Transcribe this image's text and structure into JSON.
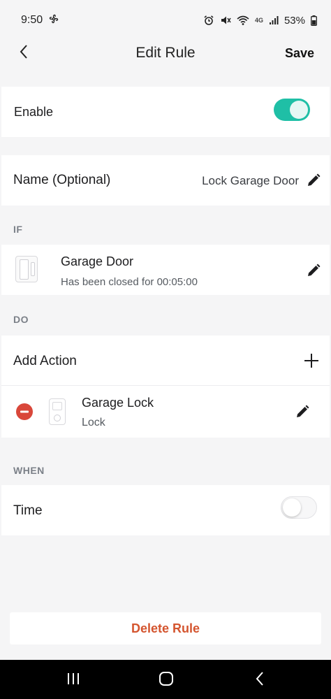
{
  "status": {
    "time": "9:50",
    "battery": "53%",
    "network": "4G"
  },
  "header": {
    "title": "Edit Rule",
    "save_label": "Save"
  },
  "enable": {
    "label": "Enable",
    "state": "on"
  },
  "name": {
    "label": "Name (Optional)",
    "value": "Lock Garage Door"
  },
  "if_section": {
    "label": "IF",
    "device_name": "Garage Door",
    "condition": "Has been closed for 00:05:00"
  },
  "do_section": {
    "label": "DO",
    "add_action_label": "Add Action",
    "action_device": "Garage Lock",
    "action": "Lock"
  },
  "when_section": {
    "label": "WHEN",
    "time_label": "Time",
    "time_state": "off"
  },
  "delete_label": "Delete Rule",
  "colors": {
    "accent": "#1fbfa6",
    "danger": "#d4552f",
    "remove": "#d9473a"
  }
}
